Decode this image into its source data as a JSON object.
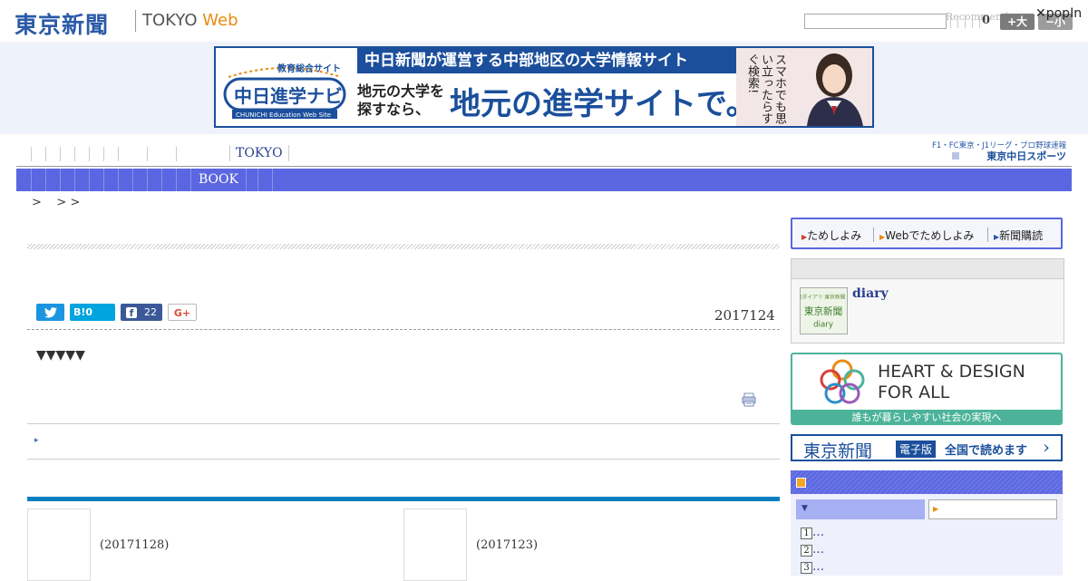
{
  "header": {
    "logo_jp": "東京新聞",
    "logo_en": "TOKYO",
    "logo_web": "Web",
    "search_placeholder": "",
    "recommend": "Recommend",
    "zero": "0",
    "font_big": "+大",
    "font_small": "−小",
    "popin": "✕popIn"
  },
  "ad": {
    "logo_caption": "教育総合サイト",
    "logo_text": "中日進学ナビ",
    "logo_sub": "CHUNICHI Education Web Site",
    "top": "中日新聞が運営する中部地区の大学情報サイト",
    "left_line1": "地元の大学を",
    "left_line2": "探すなら、",
    "big": "地元の進学サイトで。",
    "vertical": "スマホでも思い立ったらすぐ検索!"
  },
  "nav1": {
    "tokyo": "TOKYO",
    "chunichi_line1": "F1・FC東京・J1リーグ・プロ野球速報",
    "chunichi_line2": "東京中日スポーツ"
  },
  "nav2": {
    "book": "BOOK"
  },
  "breadcrumb": ">    > >",
  "article": {
    "date": "2017124",
    "triangles": "▼▼▼▼▼",
    "arrow": "▸",
    "share_tw": "",
    "share_hb": "B!0",
    "share_fb": "22",
    "share_gp": "G+"
  },
  "related": [
    {
      "date": "(20171128)"
    },
    {
      "date": "(2017123)"
    }
  ],
  "sidebar": {
    "tab1": "ためしよみ",
    "tab2": "Webでためしよみ",
    "tab3": "新聞購読",
    "diary_link": "diary",
    "diary_img_text": "思い出ダイアリ 東京新聞 diary",
    "hd_line1": "HEART & DESIGN",
    "hd_line2": "FOR ALL",
    "hd_foot": "誰もが暮らしやすい社会の実現へ",
    "ebook_title": "東京新聞",
    "ebook_badge": "電子版",
    "ebook_text": "全国で読めます",
    "rank": [
      "1",
      "2",
      "3"
    ],
    "rank_ellipsis": "…"
  },
  "colors": {
    "brand_blue": "#2b5aa8",
    "nav_blue": "#5b67e0",
    "accent_orange": "#e98b12",
    "green": "#4cb39a"
  }
}
